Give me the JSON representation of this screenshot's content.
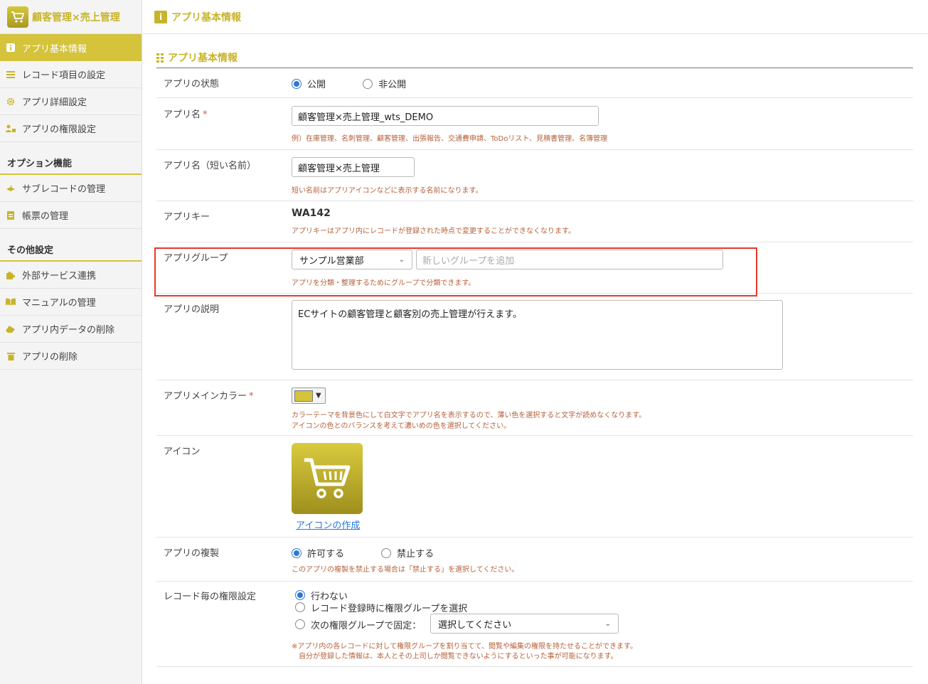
{
  "app": {
    "title": "顧客管理×売上管理"
  },
  "sidebar": {
    "items": [
      {
        "label": "アプリ基本情報",
        "icon": "info-icon"
      },
      {
        "label": "レコード項目の設定",
        "icon": "list-icon"
      },
      {
        "label": "アプリ詳細設定",
        "icon": "gear-icon"
      },
      {
        "label": "アプリの権限設定",
        "icon": "user-lock-icon"
      }
    ],
    "options_title": "オプション機能",
    "options": [
      {
        "label": "サブレコードの管理",
        "icon": "layers-icon"
      },
      {
        "label": "帳票の管理",
        "icon": "document-icon"
      }
    ],
    "other_title": "その他設定",
    "other": [
      {
        "label": "外部サービス連携",
        "icon": "puzzle-icon"
      },
      {
        "label": "マニュアルの管理",
        "icon": "book-icon"
      },
      {
        "label": "アプリ内データの削除",
        "icon": "eraser-icon"
      },
      {
        "label": "アプリの削除",
        "icon": "trash-icon"
      }
    ]
  },
  "header": {
    "title": "アプリ基本情報"
  },
  "section": {
    "title": "アプリ基本情報"
  },
  "form": {
    "status": {
      "label": "アプリの状態",
      "options": [
        "公開",
        "非公開"
      ],
      "selected": "公開"
    },
    "name": {
      "label": "アプリ名",
      "required": "*",
      "value": "顧客管理×売上管理_wts_DEMO",
      "hint": "例）在庫管理、名刺管理、顧客管理、出張報告、交通費申請、ToDoリスト、見積書管理、名簿管理"
    },
    "short_name": {
      "label": "アプリ名（短い名前）",
      "value": "顧客管理×売上管理",
      "hint": "短い名前はアプリアイコンなどに表示する名前になります。"
    },
    "key": {
      "label": "アプリキー",
      "value": "WA142",
      "hint": "アプリキーはアプリ内にレコードが登録された時点で変更することができなくなります。"
    },
    "group": {
      "label": "アプリグループ",
      "selected": "サンプル営業部",
      "new_placeholder": "新しいグループを追加",
      "hint": "アプリを分類・整理するためにグループで分類できます。"
    },
    "description": {
      "label": "アプリの説明",
      "value": "ECサイトの顧客管理と顧客別の売上管理が行えます。"
    },
    "color": {
      "label": "アプリメインカラー",
      "required": "*",
      "value": "#d4c33b",
      "hint1": "カラーテーマを背景色にして白文字でアプリ名を表示するので、薄い色を選択すると文字が読めなくなります。",
      "hint2": "アイコンの色とのバランスを考えて濃いめの色を選択してください。"
    },
    "icon": {
      "label": "アイコン",
      "icon": "shopping-cart-icon",
      "link": "アイコンの作成"
    },
    "copy": {
      "label": "アプリの複製",
      "options": [
        "許可する",
        "禁止する"
      ],
      "selected": "許可する",
      "hint": "このアプリの複製を禁止する場合は「禁止する」を選択してください。"
    },
    "record_perm": {
      "label": "レコード毎の権限設定",
      "options": [
        "行わない",
        "レコード登録時に権限グループを選択",
        "次の権限グループで固定："
      ],
      "selected": "行わない",
      "select_placeholder": "選択してください",
      "hint1": "※アプリ内の各レコードに対して権限グループを割り当てて、閲覧や編集の権限を持たせることができます。",
      "hint2": "自分が登録した情報は、本人とその上司しか閲覧できないようにするといった事が可能になります。"
    }
  }
}
